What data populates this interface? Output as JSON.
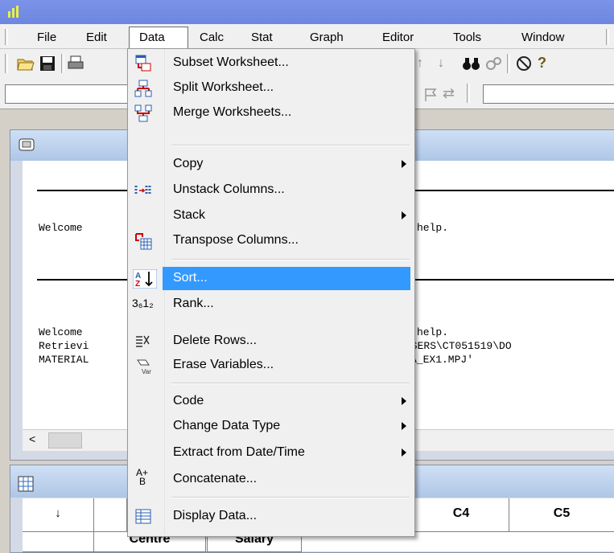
{
  "menubar": {
    "items": [
      "File",
      "Edit",
      "Data",
      "Calc",
      "Stat",
      "Graph",
      "Editor",
      "Tools",
      "Window"
    ]
  },
  "session": {
    "lines": [
      "Welcome",
      "Welcome",
      "Retrievi",
      "MATERIAL"
    ],
    "lines_right": [
      "help.",
      "help.",
      "USERS\\CT051519\\DO",
      "A_EX1.MPJ'"
    ]
  },
  "worksheet": {
    "col_headers": [
      "C4",
      "C5"
    ],
    "names": [
      "Centre",
      "Salary"
    ],
    "arrow": "↓"
  },
  "dropdown": {
    "items": [
      {
        "label": "Subset Worksheet...",
        "icon": "subset-worksheet-icon",
        "submenu": false
      },
      {
        "label": "Split Worksheet...",
        "icon": "split-worksheet-icon",
        "submenu": false
      },
      {
        "label": "Merge Worksheets...",
        "icon": "merge-worksheets-icon",
        "submenu": false
      },
      {
        "label": "Copy",
        "icon": "",
        "submenu": true
      },
      {
        "label": "Unstack Columns...",
        "icon": "unstack-columns-icon",
        "submenu": false
      },
      {
        "label": "Stack",
        "icon": "",
        "submenu": true
      },
      {
        "label": "Transpose Columns...",
        "icon": "transpose-columns-icon",
        "submenu": false
      },
      {
        "label": "Sort...",
        "icon": "sort-icon",
        "submenu": false,
        "highlighted": true
      },
      {
        "label": "Rank...",
        "icon": "rank-icon",
        "submenu": false
      },
      {
        "label": "Delete Rows...",
        "icon": "delete-rows-icon",
        "submenu": false
      },
      {
        "label": "Erase Variables...",
        "icon": "erase-variables-icon",
        "submenu": false
      },
      {
        "label": "Code",
        "icon": "",
        "submenu": true
      },
      {
        "label": "Change Data Type",
        "icon": "",
        "submenu": true
      },
      {
        "label": "Extract from Date/Time",
        "icon": "",
        "submenu": true
      },
      {
        "label": "Concatenate...",
        "icon": "concatenate-icon",
        "submenu": false
      },
      {
        "label": "Display Data...",
        "icon": "display-data-icon",
        "submenu": false
      }
    ],
    "rank_prefix": "3₆1₂",
    "concat_icon_top": "A+",
    "concat_icon_bottom": "B"
  },
  "colors": {
    "titlebar": "#6d86e0",
    "highlight": "#3399ff",
    "session_header": "#aec6e6"
  }
}
